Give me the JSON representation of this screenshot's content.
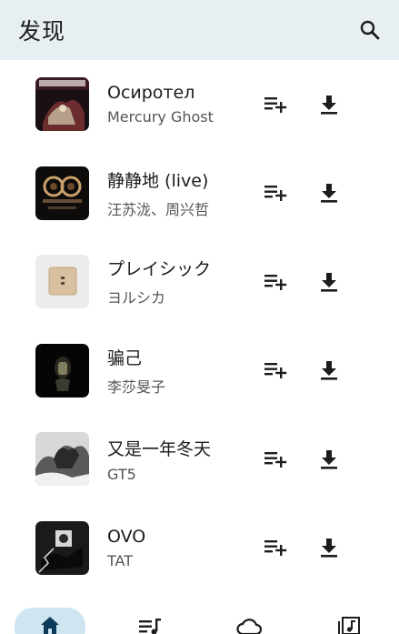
{
  "header": {
    "title": "发现"
  },
  "songs": [
    {
      "title": "Осиротел",
      "artist": "Mercury Ghost"
    },
    {
      "title": "静静地 (live)",
      "artist": "汪苏泷、周兴哲"
    },
    {
      "title": "プレイシック",
      "artist": "ヨルシカ"
    },
    {
      "title": "骗己",
      "artist": "李莎旻子"
    },
    {
      "title": "又是一年冬天",
      "artist": "GT5"
    },
    {
      "title": "OVO",
      "artist": "TAT"
    }
  ],
  "icons": {
    "search": "search-icon",
    "add_to_queue": "playlist-add-icon",
    "download": "download-icon",
    "home": "home-icon",
    "playlist": "queue-music-icon",
    "cloud": "cloud-icon",
    "library": "library-music-icon"
  },
  "colors": {
    "topbar_bg": "#e7eff3",
    "nav_active_bg": "#cfe6f1",
    "icon": "#1c1c1c",
    "active_icon": "#0d3b5a"
  }
}
